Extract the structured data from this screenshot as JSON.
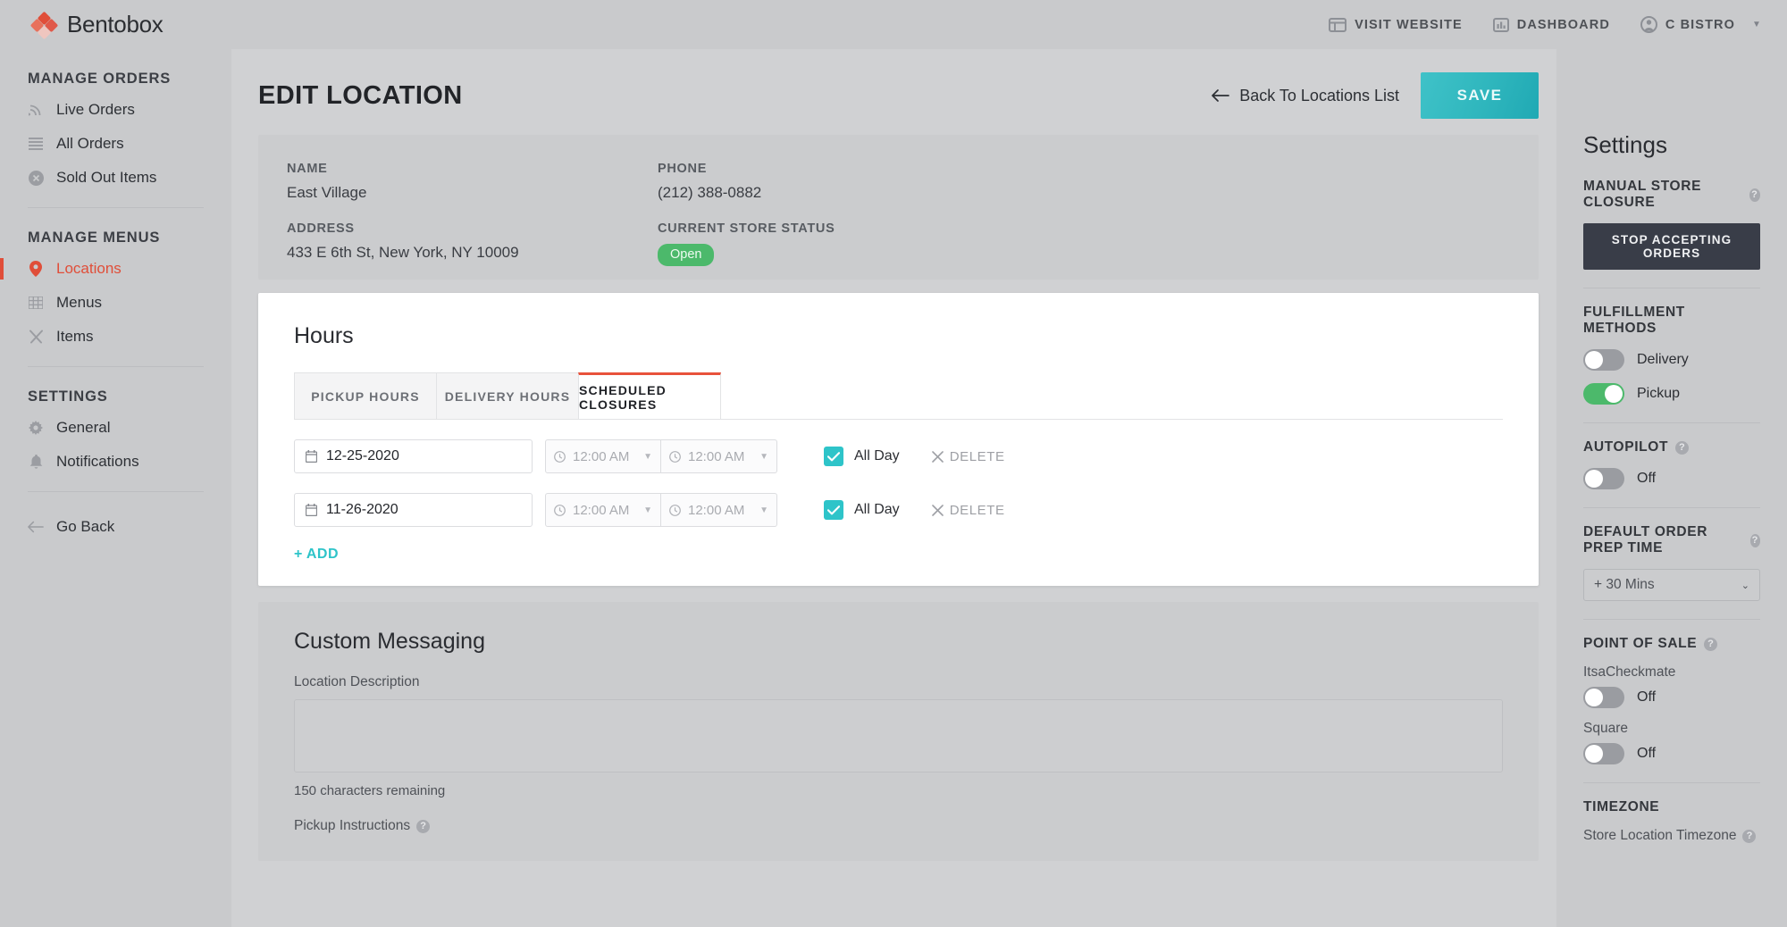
{
  "topbar": {
    "brand": "Bentobox",
    "nav": [
      {
        "label": "VISIT WEBSITE",
        "icon": "website-icon"
      },
      {
        "label": "DASHBOARD",
        "icon": "chart-icon"
      },
      {
        "label": "C BISTRO",
        "icon": "account-icon"
      }
    ]
  },
  "sidebar": {
    "groups": [
      {
        "title": "MANAGE ORDERS",
        "items": [
          {
            "label": "Live Orders",
            "icon": "rss-icon",
            "active": false
          },
          {
            "label": "All Orders",
            "icon": "list-icon",
            "active": false
          },
          {
            "label": "Sold Out Items",
            "icon": "circle-x-icon",
            "active": false
          }
        ]
      },
      {
        "title": "MANAGE MENUS",
        "items": [
          {
            "label": "Locations",
            "icon": "map-pin-icon",
            "active": true
          },
          {
            "label": "Menus",
            "icon": "grid-icon",
            "active": false
          },
          {
            "label": "Items",
            "icon": "cutlery-icon",
            "active": false
          }
        ]
      },
      {
        "title": "SETTINGS",
        "items": [
          {
            "label": "General",
            "icon": "gear-icon",
            "active": false
          },
          {
            "label": "Notifications",
            "icon": "bell-icon",
            "active": false
          }
        ]
      }
    ],
    "go_back": "Go Back"
  },
  "header": {
    "title": "EDIT LOCATION",
    "back_link": "Back To Locations List",
    "save_label": "SAVE"
  },
  "info": {
    "name_label": "NAME",
    "name_value": "East Village",
    "address_label": "ADDRESS",
    "address_value": "433 E 6th St, New York, NY 10009",
    "phone_label": "PHONE",
    "phone_value": "(212) 388-0882",
    "status_label": "CURRENT STORE STATUS",
    "status_value": "Open",
    "status_color": "#4cb96b"
  },
  "hours": {
    "title": "Hours",
    "tabs": [
      {
        "label": "PICKUP HOURS",
        "active": false
      },
      {
        "label": "DELIVERY HOURS",
        "active": false
      },
      {
        "label": "SCHEDULED CLOSURES",
        "active": true
      }
    ],
    "active_tab_accent": "#e8523b",
    "rows": [
      {
        "date": "12-25-2020",
        "start_time": "12:00 AM",
        "end_time": "12:00 AM",
        "all_day_label": "All Day",
        "all_day_checked": true,
        "delete_label": "DELETE"
      },
      {
        "date": "11-26-2020",
        "start_time": "12:00 AM",
        "end_time": "12:00 AM",
        "all_day_label": "All Day",
        "all_day_checked": true,
        "delete_label": "DELETE"
      }
    ],
    "add_label": "ADD"
  },
  "messaging": {
    "title": "Custom Messaging",
    "description_label": "Location Description",
    "description_value": "",
    "char_note": "150 characters remaining",
    "pickup_instructions_label": "Pickup Instructions"
  },
  "settings": {
    "title": "Settings",
    "manual_closure_heading": "MANUAL STORE CLOSURE",
    "stop_button": "STOP ACCEPTING ORDERS",
    "fulfillment_heading": "FULFILLMENT METHODS",
    "fulfillment": [
      {
        "label": "Delivery",
        "on": false
      },
      {
        "label": "Pickup",
        "on": true
      }
    ],
    "autopilot_heading": "AUTOPILOT",
    "autopilot": {
      "label": "Off",
      "on": false
    },
    "prep_time_heading": "DEFAULT ORDER PREP TIME",
    "prep_time_value": "+ 30 Mins",
    "pos_heading": "POINT OF SALE",
    "pos": [
      {
        "name": "ItsaCheckmate",
        "label": "Off",
        "on": false
      },
      {
        "name": "Square",
        "label": "Off",
        "on": false
      }
    ],
    "timezone_heading": "TIMEZONE",
    "timezone_sub": "Store Location Timezone"
  }
}
